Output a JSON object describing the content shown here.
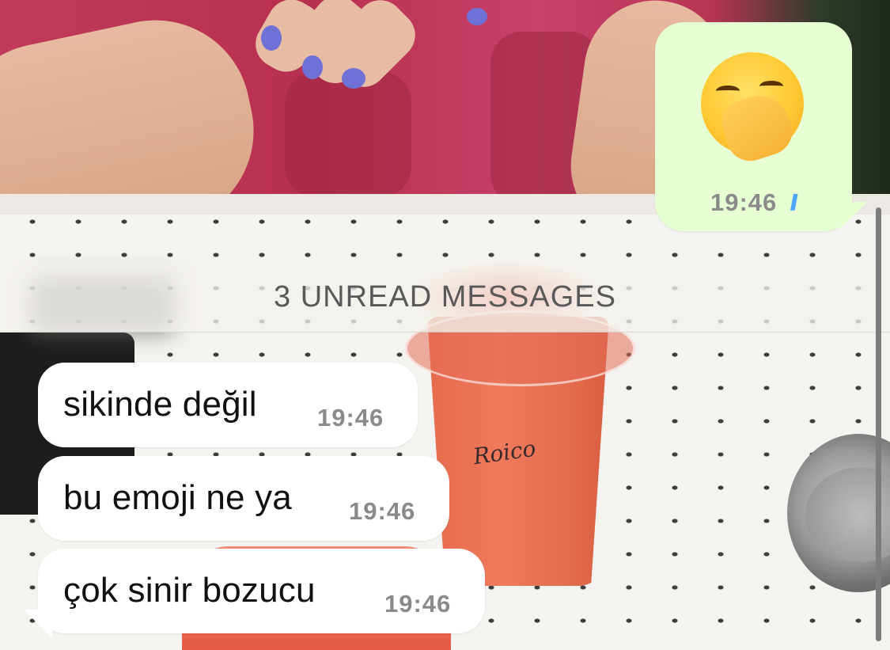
{
  "outgoing": {
    "emoji": "yawning-face",
    "time": "19:46",
    "status": "read"
  },
  "unread_banner": "3 UNREAD MESSAGES",
  "incoming": [
    {
      "text": "sikinde değil",
      "time": "19:46"
    },
    {
      "text": "bu emoji ne ya",
      "time": "19:46"
    },
    {
      "text": "çok sinir bozucu",
      "time": "19:46"
    }
  ],
  "wallpaper": {
    "cup_logo": "Roico"
  },
  "colors": {
    "outgoing_bubble": "#e6ffd3",
    "incoming_bubble": "#ffffff",
    "read_ticks": "#4fa6ff"
  }
}
